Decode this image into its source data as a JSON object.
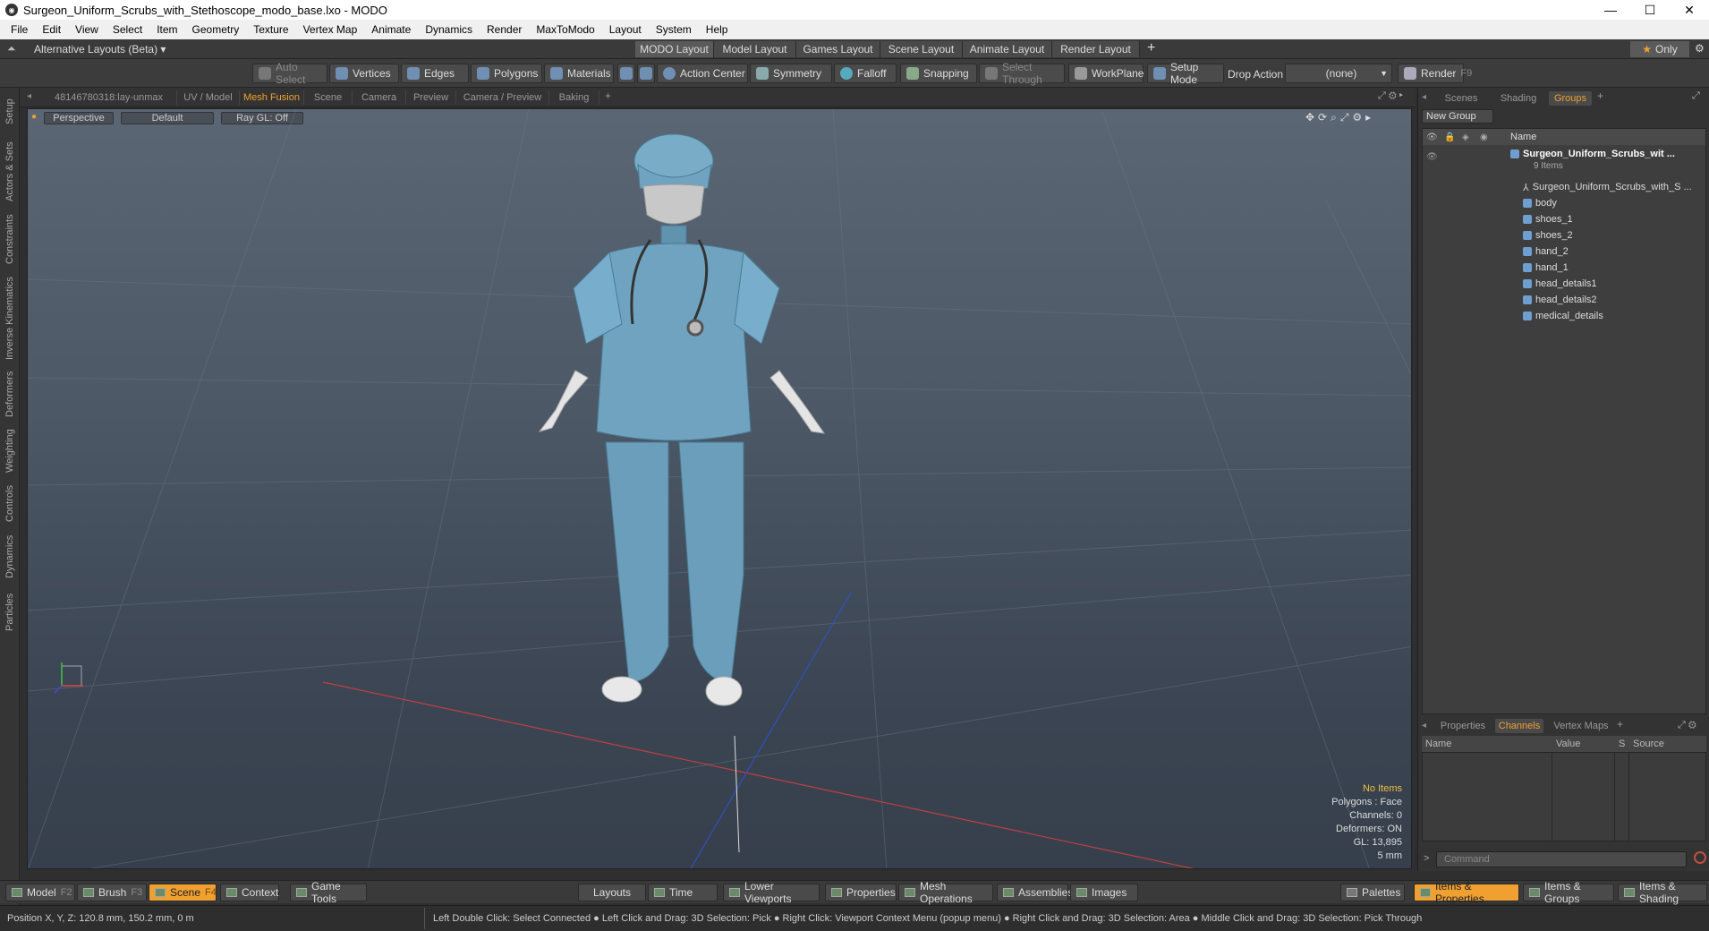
{
  "window": {
    "title": "Surgeon_Uniform_Scrubs_with_Stethoscope_modo_base.lxo - MODO"
  },
  "menu": [
    "File",
    "Edit",
    "View",
    "Select",
    "Item",
    "Geometry",
    "Texture",
    "Vertex Map",
    "Animate",
    "Dynamics",
    "Render",
    "MaxToModo",
    "Layout",
    "System",
    "Help"
  ],
  "layouts": {
    "alt_label": "Alternative Layouts (Beta)",
    "tabs": [
      "MODO Layout",
      "Model Layout",
      "Games Layout",
      "Scene Layout",
      "Animate Layout",
      "Render Layout"
    ],
    "only_label": "Only"
  },
  "toolbar": {
    "auto_select": "Auto Select",
    "vertices": "Vertices",
    "edges": "Edges",
    "polygons": "Polygons",
    "materials": "Materials",
    "action_center": "Action Center",
    "symmetry": "Symmetry",
    "falloff": "Falloff",
    "snapping": "Snapping",
    "select_through": "Select Through",
    "workplane": "WorkPlane",
    "setup_mode": "Setup Mode",
    "drop_action": "Drop Action",
    "drop_value": "(none)",
    "render": "Render",
    "render_key": "F9"
  },
  "left_tabs": [
    "Setup",
    "Actors & Sets",
    "Constraints",
    "Inverse Kinematics",
    "Deformers",
    "Weighting",
    "Controls",
    "Dynamics",
    "Particles"
  ],
  "viewport_tabs": [
    "48146780318:lay-unmax",
    "UV / Model",
    "Mesh Fusion",
    "Scene",
    "Camera",
    "Preview",
    "Camera / Preview",
    "Baking"
  ],
  "viewport": {
    "view": "Perspective",
    "shading": "Default",
    "raygl": "Ray GL: Off",
    "stats": [
      "No Items",
      "Polygons : Face",
      "Channels: 0",
      "Deformers: ON",
      "GL: 13,895",
      "5 mm"
    ]
  },
  "right_tabs": [
    "Scenes",
    "Shading",
    "Groups"
  ],
  "groups": {
    "new_group": "New Group",
    "name_header": "Name",
    "root": "Surgeon_Uniform_Scrubs_wit ...",
    "root_count": "9 Items",
    "items": [
      "Surgeon_Uniform_Scrubs_with_S ...",
      "body",
      "shoes_1",
      "shoes_2",
      "hand_2",
      "hand_1",
      "head_details1",
      "head_details2",
      "medical_details"
    ]
  },
  "channels": {
    "tabs": [
      "Properties",
      "Channels",
      "Vertex Maps"
    ],
    "headers": [
      "Name",
      "Value",
      "S",
      "Source"
    ],
    "command_placeholder": "Command"
  },
  "bottom": {
    "model": "Model",
    "model_key": "F2",
    "brush": "Brush",
    "brush_key": "F3",
    "scene": "Scene",
    "scene_key": "F4",
    "context": "Context",
    "game_tools": "Game Tools",
    "layouts": "Layouts",
    "time": "Time",
    "lower_viewports": "Lower Viewports",
    "properties": "Properties",
    "mesh_operations": "Mesh Operations",
    "assemblies": "Assemblies",
    "images": "Images",
    "palettes": "Palettes",
    "items_properties": "Items & Properties",
    "items_groups": "Items & Groups",
    "items_shading": "Items & Shading"
  },
  "status": {
    "position": "Position X, Y, Z:   120.8 mm, 150.2 mm, 0 m",
    "hints": "Left Double Click: Select Connected ● Left Click and Drag: 3D Selection: Pick ● Right Click: Viewport Context Menu (popup menu) ● Right Click and Drag: 3D Selection: Area ● Middle Click and Drag: 3D Selection: Pick Through"
  },
  "colors": {
    "accent": "#f0a030",
    "mesh": "#6fa3c0"
  }
}
